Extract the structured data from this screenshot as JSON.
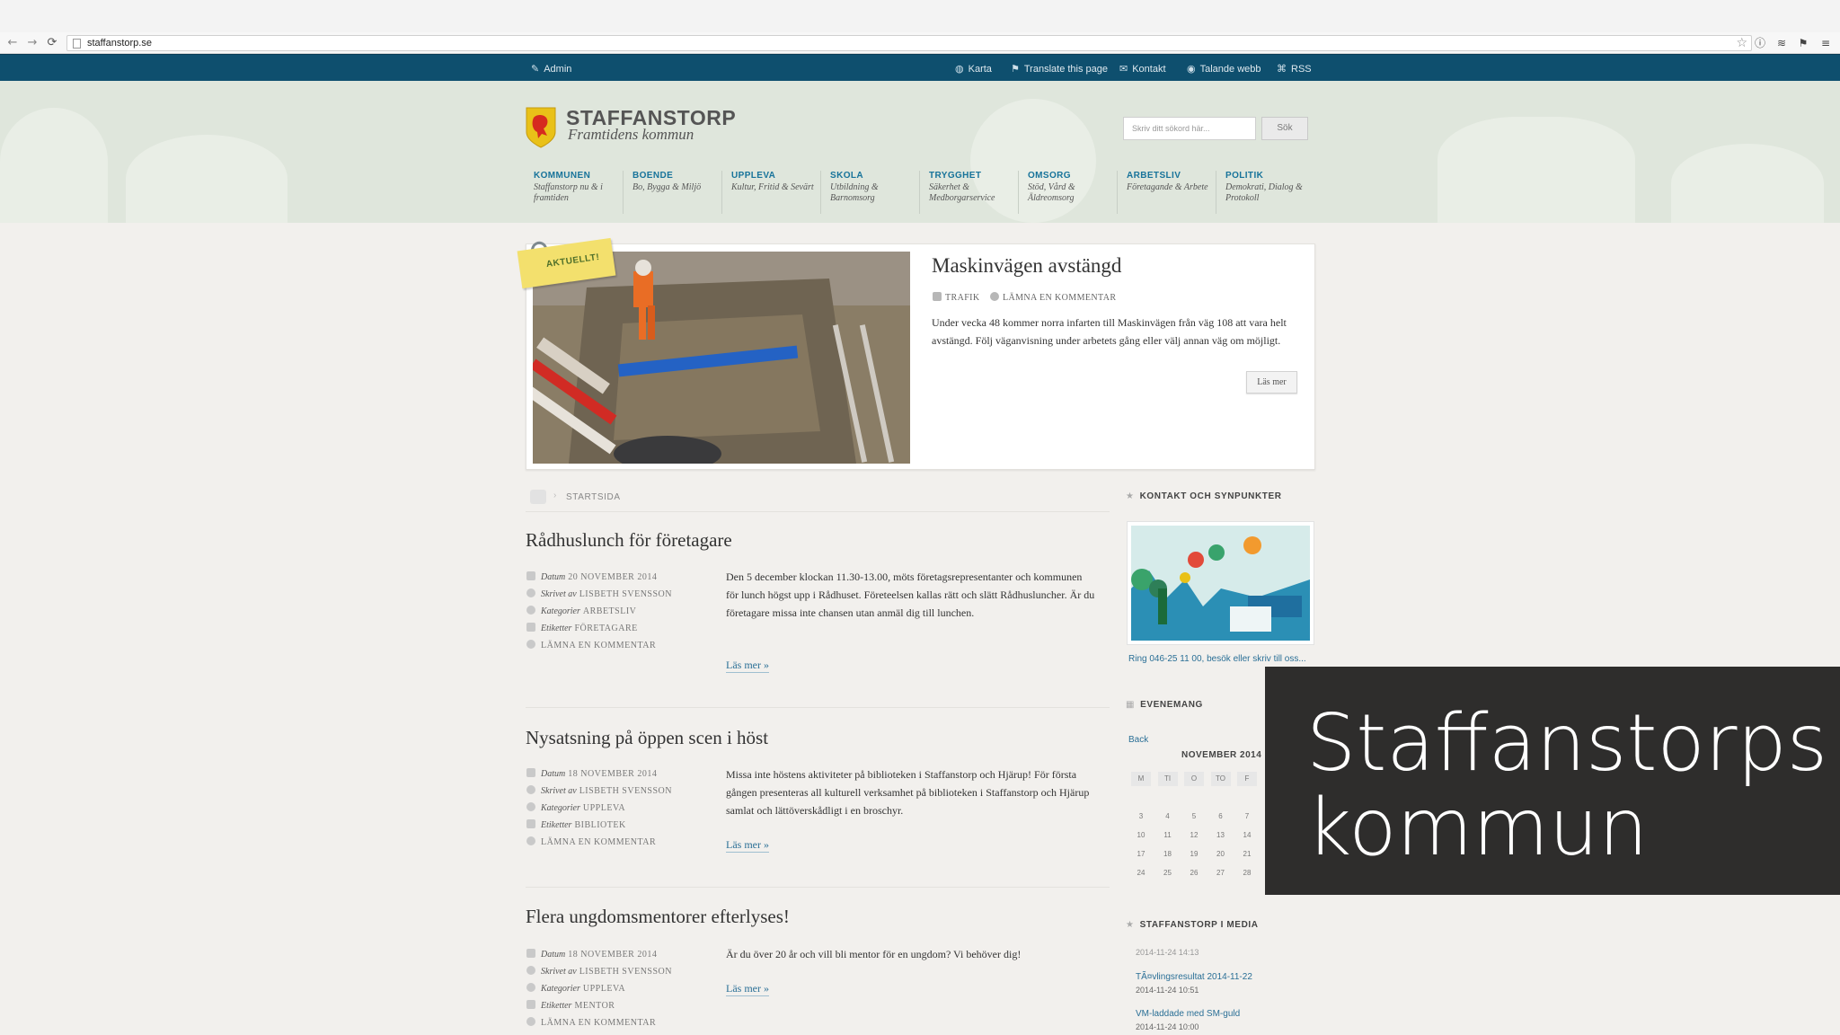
{
  "browser": {
    "url": "staffanstorp.se",
    "nav": {
      "back_icon": "←",
      "forward_icon": "→",
      "reload_icon": "⟳"
    },
    "star_icon": "☆",
    "ext_icons": [
      "ⓘ",
      "≋",
      "⚑",
      "≡"
    ]
  },
  "topbar": {
    "admin": "Admin",
    "links": [
      "Karta",
      "Translate this page",
      "Kontakt",
      "Talande webb",
      "RSS"
    ],
    "icons": {
      "admin": "✎",
      "karta": "◍",
      "translate": "⚑",
      "kontakt": "✉",
      "talande": "◉",
      "rss": "⌘"
    }
  },
  "logo": {
    "title": "STAFFANSTORP",
    "subtitle": "Framtidens kommun"
  },
  "search": {
    "placeholder": "Skriv ditt sökord här...",
    "button": "Sök"
  },
  "mainnav": [
    {
      "title": "KOMMUNEN",
      "sub": "Staffanstorp nu & i framtiden"
    },
    {
      "title": "BOENDE",
      "sub": "Bo, Bygga & Miljö"
    },
    {
      "title": "UPPLEVA",
      "sub": "Kultur, Fritid & Sevärt"
    },
    {
      "title": "SKOLA",
      "sub": "Utbildning & Barnomsorg"
    },
    {
      "title": "TRYGGHET",
      "sub": "Säkerhet & Medborgarservice"
    },
    {
      "title": "OMSORG",
      "sub": "Stöd, Vård & Äldreomsorg"
    },
    {
      "title": "ARBETSLIV",
      "sub": "Företagande & Arbete"
    },
    {
      "title": "POLITIK",
      "sub": "Demokrati, Dialog & Protokoll"
    }
  ],
  "featured": {
    "badge": "AKTUELLT!",
    "title": "Maskinvägen avstängd",
    "tag": "TRAFIK",
    "comment": "LÄMNA EN KOMMENTAR",
    "text": "Under vecka 48 kommer norra infarten till Maskinvägen från väg 108 att vara helt avstängd. Följ väganvisning under arbetets gång eller välj annan väg om möjligt.",
    "more": "Läs mer"
  },
  "breadcrumb": {
    "current": "STARTSIDA"
  },
  "posts": [
    {
      "title": "Rådhuslunch för företagare",
      "datum": "20 NOVEMBER 2014",
      "skrivet": "LISBETH SVENSSON",
      "kategorier": "ARBETSLIV",
      "etiketter": "FÖRETAGARE",
      "comment": "LÄMNA EN KOMMENTAR",
      "body": "Den 5 december klockan 11.30-13.00, möts företagsrepresentanter och kommunen för lunch högst upp i Rådhuset. Företeelsen kallas rätt och slätt Rådhusluncher. Är du företagare missa inte chansen utan anmäl dig till lunchen.",
      "more": "Läs mer »"
    },
    {
      "title": "Nysatsning på öppen scen i höst",
      "datum": "18 NOVEMBER 2014",
      "skrivet": "LISBETH SVENSSON",
      "kategorier": "UPPLEVA",
      "etiketter": "BIBLIOTEK",
      "comment": "LÄMNA EN KOMMENTAR",
      "body": "Missa inte höstens aktiviteter på biblioteken i Staffanstorp och Hjärup! För första gången presenteras all kulturell verksamhet på biblioteken i Staffanstorp och Hjärup samlat och lättöverskådligt i en broschyr.",
      "more": "Läs mer »"
    },
    {
      "title": "Flera ungdomsmentorer efterlyses!",
      "datum": "18 NOVEMBER 2014",
      "skrivet": "LISBETH SVENSSON",
      "kategorier": "UPPLEVA",
      "etiketter": "MENTOR",
      "comment": "LÄMNA EN KOMMENTAR",
      "body": "Är du över 20 år och vill bli mentor för en ungdom? Vi behöver dig!",
      "more": "Läs mer »"
    }
  ],
  "labels": {
    "datum": "Datum",
    "skrivet": "Skrivet av",
    "kategorier": "Kategorier",
    "etiketter": "Etiketter"
  },
  "sidebar": {
    "kontakt_title": "KONTAKT OCH SYNPUNKTER",
    "kontakt_caption": "Ring 046-25 11 00, besök eller skriv till oss...",
    "evenemang_title": "EVENEMANG",
    "calendar": {
      "back": "Back",
      "month": "NOVEMBER 2014",
      "weekdays": [
        "M",
        "TI",
        "O",
        "TO",
        "F"
      ],
      "weeks": [
        [
          "3",
          "4",
          "5",
          "6",
          "7"
        ],
        [
          "10",
          "11",
          "12",
          "13",
          "14"
        ],
        [
          "17",
          "18",
          "19",
          "20",
          "21"
        ],
        [
          "24",
          "25",
          "26",
          "27",
          "28"
        ]
      ]
    },
    "media_title": "STAFFANSTORP I MEDIA",
    "media": [
      {
        "title": "TÃ¤vlingsresultat 2014-11-22",
        "date": "2014-11-24 10:51"
      },
      {
        "title": "VM-laddade med SM-guld",
        "date": "2014-11-24 10:00"
      }
    ],
    "media_cut_date": "2014-11-24 14:13"
  },
  "overlay": {
    "text": "Staffanstorps kommun"
  }
}
